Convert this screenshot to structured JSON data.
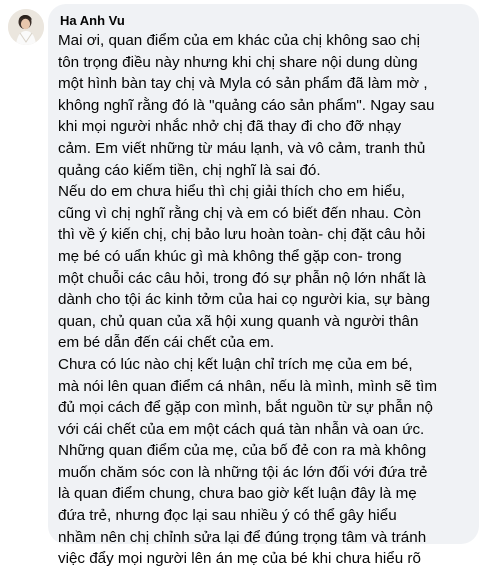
{
  "comment": {
    "author": "Ha Anh Vu",
    "paragraphs": [
      [
        "Mai ơi, quan điểm của em khác của chị không sao chị",
        "tôn trọng điều này nhưng khi chị share nội dung dùng",
        "một hình bàn tay chị và Myla có sản phẩm đã làm mờ ,",
        " không nghĩ rằng đó là \"quảng cáo sản phẩm\". Ngay sau",
        "khi mọi người nhắc nhở chị đã thay đi cho đỡ nhạy",
        "cảm. Em viết những từ máu lạnh, và vô cảm, tranh thủ",
        "quảng cáo kiếm tiền, chị nghĩ là sai đó."
      ],
      [
        "Nếu do em chưa hiểu thì chị giải thích cho em hiểu,",
        "cũng vì chị nghĩ rằng chị và em có biết đến nhau. Còn",
        "thì về ý kiến chị, chị bảo lưu hoàn toàn- chị đặt câu hỏi",
        "mẹ bé có uẩn khúc gì mà không thể gặp con- trong",
        "một chuỗi các câu hỏi, trong đó sự phẫn nộ lớn nhất là",
        "dành cho tội ác kinh tởm của hai cọ người kia, sự bàng",
        "quan, chủ quan của xã hội xung quanh và người thân",
        "em bé dẫn đến cái chết của em."
      ],
      [
        "Chưa có lúc nào chị kết luận chỉ trích mẹ của em bé,",
        "mà nói lên quan điểm cá nhân, nếu là mình, mình sẽ tìm",
        "đủ mọi cách để gặp con mình, bắt nguồn từ sự phẫn nộ",
        "với cái chết của em một cách quá tàn nhẫn và oan ức.",
        "Những quan điểm của mẹ, của bố đẻ con ra mà không",
        "muốn chăm sóc con là những tội ác lớn đối với đứa trẻ",
        "là quan điểm chung, chưa bao giờ kết luận đây là mẹ",
        "đứa trẻ, nhưng đọc lại sau nhiều ý có thể gây hiểu",
        "nhầm nên chị chỉnh sửa lại để đúng trọng tâm và tránh",
        "việc đẩy mọi người lên án mẹ của bé khi chưa hiểu rõ"
      ]
    ]
  },
  "colors": {
    "bubble_bg": "#f0f2f5",
    "text": "#050505"
  }
}
